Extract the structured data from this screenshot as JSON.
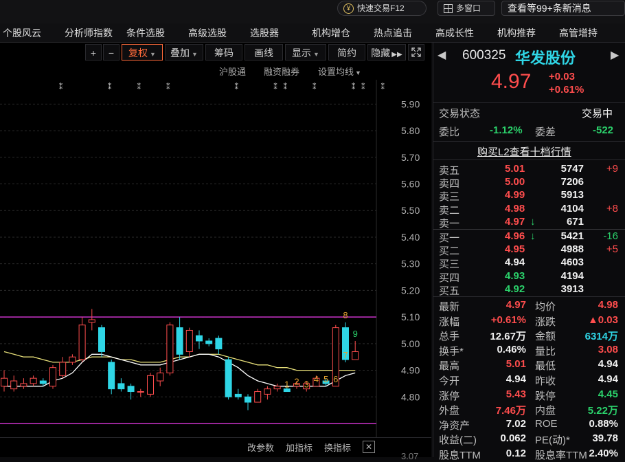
{
  "topbar": {
    "quick_trade": "快速交易F12",
    "multi_window": "多窗口",
    "news": "查看等99+条新消息"
  },
  "nav": [
    "个股风云",
    "分析师指数",
    "条件选股",
    "高级选股",
    "选股器",
    "机构增仓",
    "热点追击",
    "高成长性",
    "机构推荐",
    "高管增持"
  ],
  "chart_toolbar": {
    "plus": "+",
    "minus": "−",
    "fuquan": "复权",
    "diejia": "叠加",
    "chouma": "筹码",
    "huaxian": "画线",
    "xianshi": "显示",
    "jianyue": "简约",
    "yincang": "隐藏"
  },
  "chart_subrow": {
    "hugutong": "沪股通",
    "rongzi": "融资融券",
    "shezhi": "设置均线"
  },
  "chart_bottom": {
    "gaicanshu": "改参数",
    "jiazhibiao": "加指标",
    "huanzhibiao": "换指标"
  },
  "colors": {
    "up": "#ff4d4d",
    "down": "#2fd6e6",
    "ma_white": "#ffffff",
    "ma_yellow": "#e8e07a",
    "boundary": "#cc33cc",
    "gold_marker": "#e0a030",
    "green_marker": "#2bd26b"
  },
  "chart_data": {
    "type": "candlestick",
    "ylim": [
      4.7,
      5.95
    ],
    "y_ticks": [
      "5.90",
      "5.80",
      "5.70",
      "5.60",
      "5.50",
      "5.40",
      "5.30",
      "5.20",
      "5.10",
      "5.00",
      "4.90",
      "4.80"
    ],
    "upper_line": 5.1,
    "lower_line": 4.7,
    "candles": [
      {
        "o": 4.84,
        "c": 4.87,
        "h": 4.9,
        "l": 4.82
      },
      {
        "o": 4.83,
        "c": 4.86,
        "h": 4.88,
        "l": 4.82
      },
      {
        "o": 4.84,
        "c": 4.85,
        "h": 4.87,
        "l": 4.83
      },
      {
        "o": 4.85,
        "c": 4.87,
        "h": 4.88,
        "l": 4.84
      },
      {
        "o": 4.86,
        "c": 4.85,
        "h": 4.87,
        "l": 4.84
      },
      {
        "o": 4.84,
        "c": 4.91,
        "h": 4.92,
        "l": 4.83
      },
      {
        "o": 4.88,
        "c": 4.93,
        "h": 4.95,
        "l": 4.87
      },
      {
        "o": 4.93,
        "c": 4.95,
        "h": 4.96,
        "l": 4.92
      },
      {
        "o": 4.94,
        "c": 5.07,
        "h": 5.1,
        "l": 4.93
      },
      {
        "o": 5.08,
        "c": 5.09,
        "h": 5.13,
        "l": 5.05
      },
      {
        "o": 5.06,
        "c": 4.97,
        "h": 5.07,
        "l": 4.95
      },
      {
        "o": 4.93,
        "c": 4.83,
        "h": 4.94,
        "l": 4.81
      },
      {
        "o": 4.85,
        "c": 4.83,
        "h": 4.87,
        "l": 4.82
      },
      {
        "o": 4.84,
        "c": 4.82,
        "h": 4.85,
        "l": 4.79
      },
      {
        "o": 4.82,
        "c": 4.82,
        "h": 4.83,
        "l": 4.8
      },
      {
        "o": 4.81,
        "c": 4.88,
        "h": 4.89,
        "l": 4.8
      },
      {
        "o": 4.86,
        "c": 4.89,
        "h": 4.91,
        "l": 4.84
      },
      {
        "o": 4.89,
        "c": 5.07,
        "h": 5.08,
        "l": 4.88
      },
      {
        "o": 5.06,
        "c": 4.96,
        "h": 5.1,
        "l": 4.94
      },
      {
        "o": 4.97,
        "c": 5.05,
        "h": 5.06,
        "l": 4.95
      },
      {
        "o": 5.03,
        "c": 5.01,
        "h": 5.05,
        "l": 4.98
      },
      {
        "o": 5.01,
        "c": 5.0,
        "h": 5.02,
        "l": 4.99
      },
      {
        "o": 5.02,
        "c": 4.98,
        "h": 5.03,
        "l": 4.96
      },
      {
        "o": 4.94,
        "c": 4.8,
        "h": 4.95,
        "l": 4.79
      },
      {
        "o": 4.81,
        "c": 4.8,
        "h": 4.83,
        "l": 4.79
      },
      {
        "o": 4.8,
        "c": 4.78,
        "h": 4.81,
        "l": 4.75
      },
      {
        "o": 4.78,
        "c": 4.82,
        "h": 4.83,
        "l": 4.78
      },
      {
        "o": 4.81,
        "c": 4.83,
        "h": 4.84,
        "l": 4.79
      },
      {
        "o": 4.83,
        "c": 4.84,
        "h": 4.85,
        "l": 4.82
      },
      {
        "o": 4.83,
        "c": 4.82,
        "h": 4.85,
        "l": 4.82
      },
      {
        "o": 4.84,
        "c": 4.85,
        "h": 4.86,
        "l": 4.83
      },
      {
        "o": 4.83,
        "c": 4.85,
        "h": 4.86,
        "l": 4.82
      },
      {
        "o": 4.84,
        "c": 4.87,
        "h": 4.88,
        "l": 4.84
      },
      {
        "o": 4.86,
        "c": 4.85,
        "h": 4.87,
        "l": 4.84
      },
      {
        "o": 4.84,
        "c": 5.06,
        "h": 5.07,
        "l": 4.84
      },
      {
        "o": 5.06,
        "c": 4.94,
        "h": 5.08,
        "l": 4.93
      },
      {
        "o": 4.94,
        "c": 4.97,
        "h": 5.01,
        "l": 4.94
      }
    ],
    "ma_white": [
      4.84,
      4.84,
      4.84,
      4.84,
      4.84,
      4.86,
      4.87,
      4.89,
      4.93,
      4.96,
      4.96,
      4.95,
      4.94,
      4.93,
      4.92,
      4.92,
      4.92,
      4.93,
      4.94,
      4.95,
      4.96,
      4.96,
      4.95,
      4.93,
      4.91,
      4.88,
      4.86,
      4.85,
      4.84,
      4.84,
      4.84,
      4.84,
      4.84,
      4.84,
      4.86,
      4.88,
      4.89
    ],
    "ma_yellow": [
      4.97,
      4.96,
      4.95,
      4.95,
      4.94,
      4.93,
      4.93,
      4.93,
      4.94,
      4.95,
      4.95,
      4.95,
      4.94,
      4.94,
      4.93,
      4.93,
      4.93,
      4.94,
      4.95,
      4.95,
      4.96,
      4.96,
      4.96,
      4.95,
      4.94,
      4.93,
      4.92,
      4.92,
      4.91,
      4.91,
      4.9,
      4.9,
      4.9,
      4.9,
      4.9,
      4.9,
      4.9
    ],
    "markers": [
      {
        "i": 29,
        "t": "1",
        "color": "gold"
      },
      {
        "i": 30,
        "t": "2",
        "color": "gold"
      },
      {
        "i": 31,
        "t": "3",
        "color": "gold"
      },
      {
        "i": 32,
        "t": "4",
        "color": "gold"
      },
      {
        "i": 33,
        "t": "5",
        "color": "gold"
      },
      {
        "i": 34,
        "t": "6",
        "color": "gold"
      },
      {
        "i": 35,
        "t": "7",
        "color": "gold"
      },
      {
        "i": 35,
        "t": "8",
        "color": "gold",
        "top": true
      },
      {
        "i": 36,
        "t": "9",
        "color": "green",
        "top": true
      }
    ]
  },
  "quote": {
    "code": "600325",
    "name": "华发股份",
    "price": "4.97",
    "change": "+0.03",
    "change_pct": "+0.61%",
    "status_label": "交易状态",
    "status_value": "交易中",
    "weibi_label": "委比",
    "weibi_value": "-1.12%",
    "weicha_label": "委差",
    "weicha_value": "-522",
    "l2_link": "购买L2查看十档行情"
  },
  "order_book": {
    "asks": [
      {
        "label": "卖五",
        "price": "5.01",
        "vol": "5747",
        "delta": "+9"
      },
      {
        "label": "卖四",
        "price": "5.00",
        "vol": "7206",
        "delta": ""
      },
      {
        "label": "卖三",
        "price": "4.99",
        "vol": "5913",
        "delta": ""
      },
      {
        "label": "卖二",
        "price": "4.98",
        "vol": "4104",
        "delta": "+8"
      },
      {
        "label": "卖一",
        "price": "4.97",
        "vol": "671",
        "delta": ""
      }
    ],
    "bids": [
      {
        "label": "买一",
        "price": "4.96",
        "vol": "5421",
        "delta": "-16"
      },
      {
        "label": "买二",
        "price": "4.95",
        "vol": "4988",
        "delta": "+5"
      },
      {
        "label": "买三",
        "price": "4.94",
        "vol": "4603",
        "delta": ""
      },
      {
        "label": "买四",
        "price": "4.93",
        "vol": "4194",
        "delta": ""
      },
      {
        "label": "买五",
        "price": "4.92",
        "vol": "3913",
        "delta": ""
      }
    ]
  },
  "stats": [
    {
      "l1": "最新",
      "v1": "4.97",
      "c1": "red",
      "l2": "均价",
      "v2": "4.98",
      "c2": "red"
    },
    {
      "l1": "涨幅",
      "v1": "+0.61%",
      "c1": "red",
      "l2": "涨跌",
      "v2": "▲0.03",
      "c2": "red"
    },
    {
      "l1": "总手",
      "v1": "12.67万",
      "c1": "white",
      "l2": "金额",
      "v2": "6314万",
      "c2": "cyan"
    },
    {
      "l1": "换手*",
      "v1": "0.46%",
      "c1": "white",
      "l2": "量比",
      "v2": "3.08",
      "c2": "red"
    },
    {
      "l1": "最高",
      "v1": "5.01",
      "c1": "red",
      "l2": "最低",
      "v2": "4.94",
      "c2": "white"
    },
    {
      "l1": "今开",
      "v1": "4.94",
      "c1": "white",
      "l2": "昨收",
      "v2": "4.94",
      "c2": "white"
    },
    {
      "l1": "涨停",
      "v1": "5.43",
      "c1": "red",
      "l2": "跌停",
      "v2": "4.45",
      "c2": "green"
    },
    {
      "l1": "外盘",
      "v1": "7.46万",
      "c1": "red",
      "l2": "内盘",
      "v2": "5.22万",
      "c2": "green"
    },
    {
      "l1": "净资产",
      "v1": "7.02",
      "c1": "white",
      "l2": "ROE",
      "v2": "0.88%",
      "c2": "white"
    },
    {
      "l1": "收益(二)",
      "v1": "0.062",
      "c1": "white",
      "l2": "PE(动)*",
      "v2": "39.78",
      "c2": "white"
    },
    {
      "l1": "股息TTM",
      "v1": "0.12",
      "c1": "white",
      "l2": "股息率TTM",
      "v2": "2.40%",
      "c2": "white"
    }
  ],
  "axis_partial": "3.07"
}
